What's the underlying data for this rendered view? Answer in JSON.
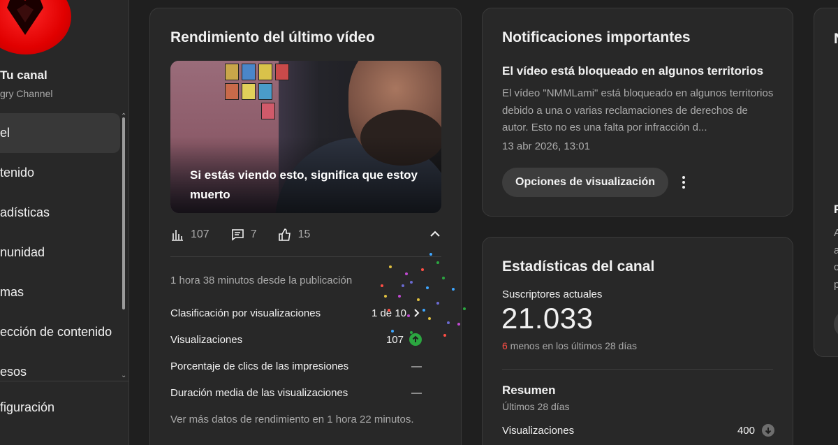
{
  "sidebar": {
    "channel_title": "Tu canal",
    "channel_name": "gry Channel",
    "items": [
      {
        "label": "el",
        "active": true
      },
      {
        "label": "tenido"
      },
      {
        "label": "adísticas"
      },
      {
        "label": "nunidad"
      },
      {
        "label": "mas"
      },
      {
        "label": "ección de contenido"
      },
      {
        "label": "esos"
      }
    ],
    "settings_label": "figuración"
  },
  "video_card": {
    "title": "Rendimiento del último vídeo",
    "thumbnail_title": "Si estás viendo esto, significa que estoy muerto",
    "views": "107",
    "comments": "7",
    "likes": "15",
    "since_published": "1 hora 38 minutos desde la publicación",
    "metrics": [
      {
        "label": "Clasificación por visualizaciones",
        "value": "1 de 10"
      },
      {
        "label": "Visualizaciones",
        "value": "107"
      },
      {
        "label": "Porcentaje de clics de las impresiones",
        "value": "—"
      },
      {
        "label": "Duración media de las visualizaciones",
        "value": "—"
      }
    ],
    "more_data": "Ver más datos de rendimiento en 1 hora 22 minutos."
  },
  "notifications_card": {
    "title": "Notificaciones importantes",
    "heading": "El vídeo está bloqueado en algunos territorios",
    "body": "El vídeo \"NMMLami\" está bloqueado en algunos territorios debido a una o varias reclamaciones de derechos de autor. Esto no es una falta por infracción d...",
    "date": "13 abr 2026, 13:01",
    "button_label": "Opciones de visualización"
  },
  "stats_card": {
    "title": "Estadísticas del canal",
    "subscribers_label": "Suscriptores actuales",
    "subscribers_value": "21.033",
    "change_number": "6",
    "change_text": " menos en los últimos 28 días",
    "summary_title": "Resumen",
    "summary_period": "Últimos 28 días",
    "views_label": "Visualizaciones",
    "views_value": "400"
  },
  "partial_card": {
    "t1": "N",
    "t2": "P",
    "lines": [
      "A",
      "a",
      "c",
      "p"
    ]
  },
  "colors": {
    "background": "#1f1f1f",
    "card": "#282828",
    "accent_up": "#2ba640",
    "accent_red": "#ff4e45"
  },
  "icons": [
    "bar-chart-icon",
    "comment-icon",
    "thumbs-up-icon",
    "chevron-up-icon",
    "chevron-right-icon",
    "arrow-up-icon",
    "arrow-down-icon",
    "more-vert-icon"
  ]
}
